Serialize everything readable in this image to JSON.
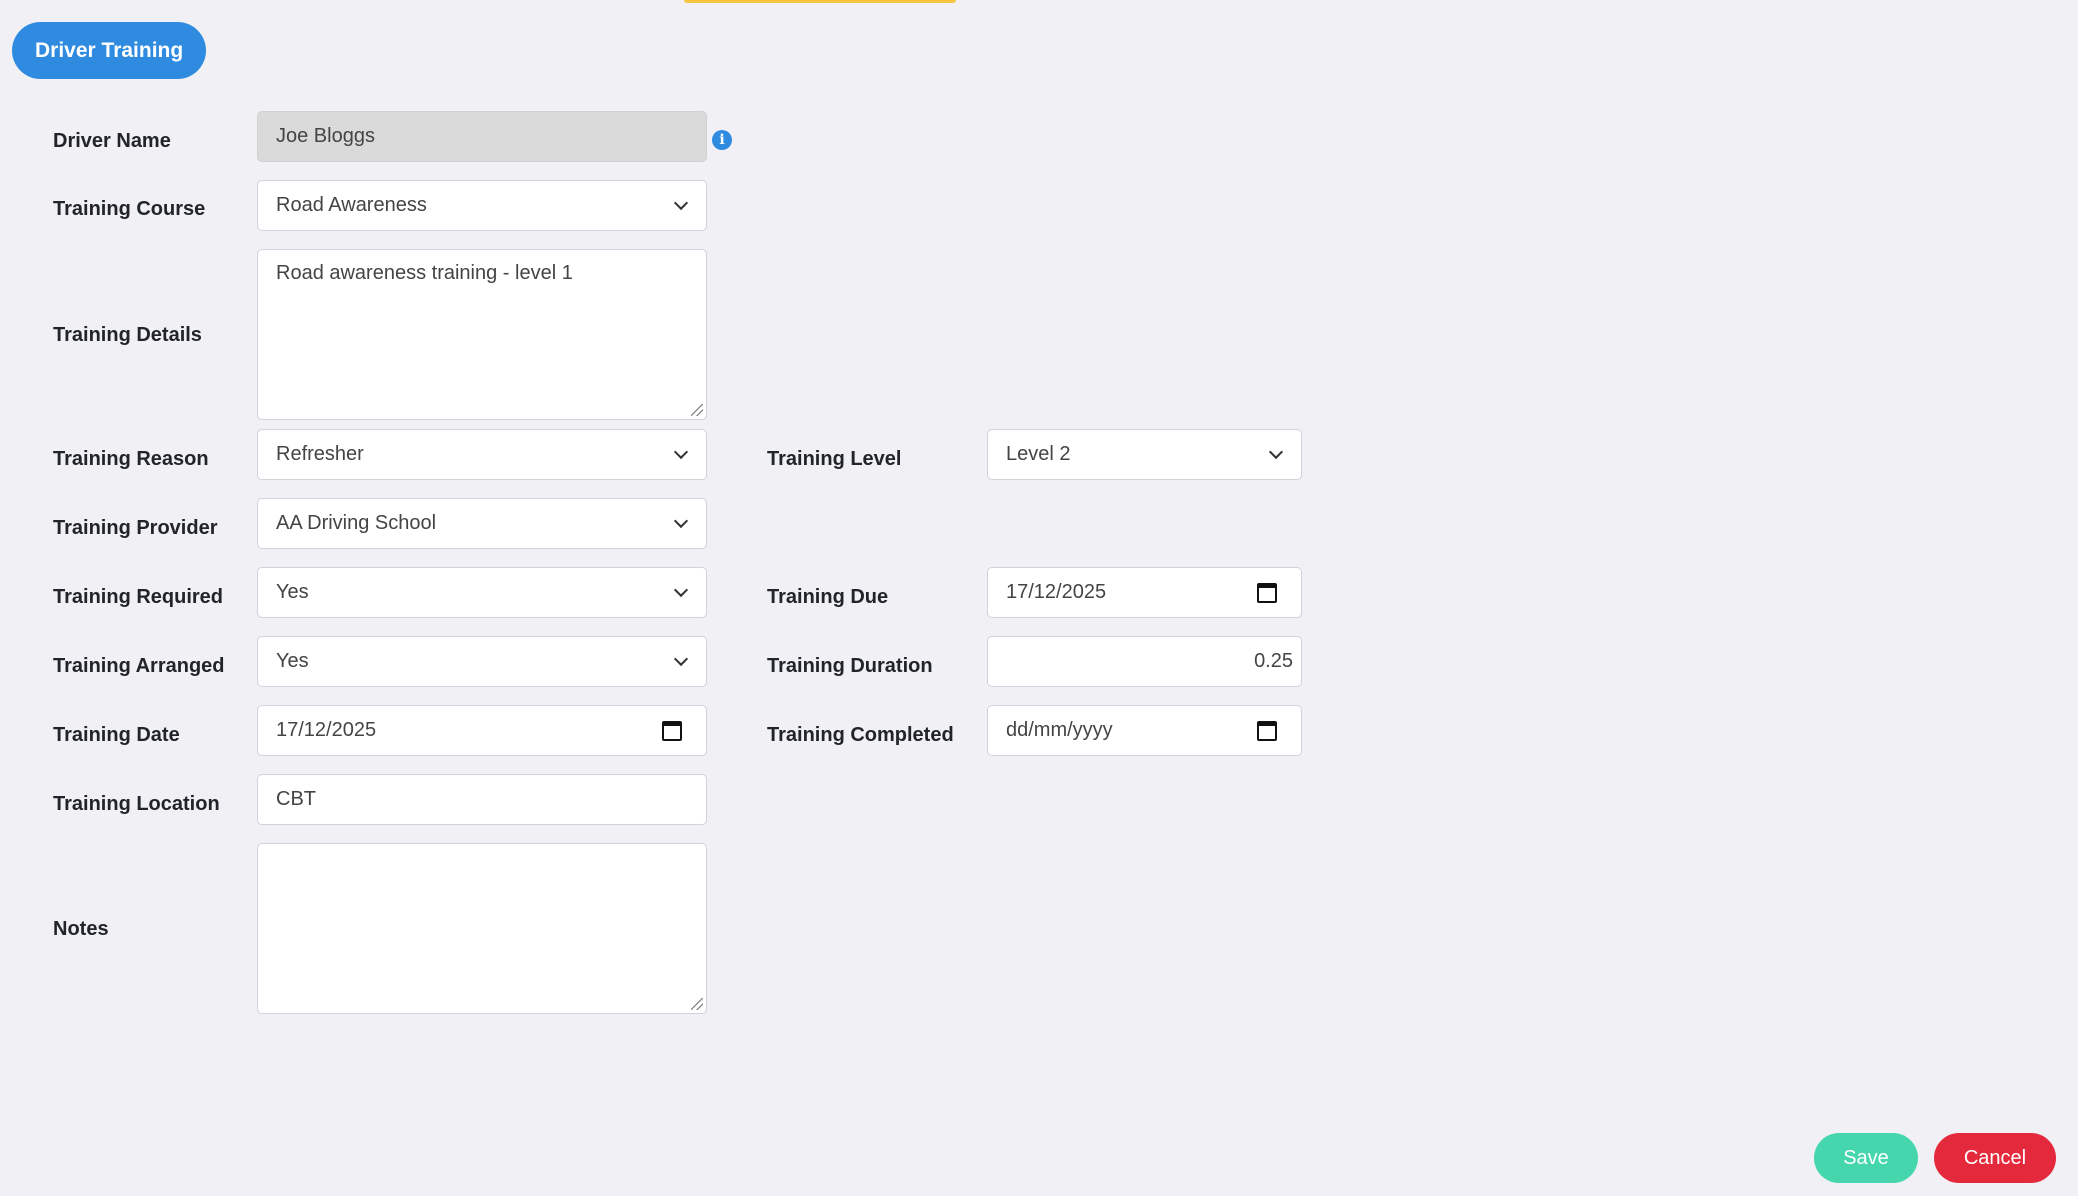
{
  "header": {
    "title": "Driver Training"
  },
  "form": {
    "driver_name": {
      "label": "Driver Name",
      "value": "Joe Bloggs",
      "info_icon": "info-icon"
    },
    "training_course": {
      "label": "Training Course",
      "value": "Road Awareness"
    },
    "training_details": {
      "label": "Training Details",
      "value": "Road awareness training - level 1"
    },
    "training_reason": {
      "label": "Training Reason",
      "value": "Refresher"
    },
    "training_level": {
      "label": "Training Level",
      "value": "Level 2"
    },
    "training_provider": {
      "label": "Training Provider",
      "value": "AA Driving School"
    },
    "training_required": {
      "label": "Training Required",
      "value": "Yes"
    },
    "training_due": {
      "label": "Training Due",
      "value": "17/12/2025"
    },
    "training_arranged": {
      "label": "Training Arranged",
      "value": "Yes"
    },
    "training_duration": {
      "label": "Training Duration",
      "value": "0.25"
    },
    "training_date": {
      "label": "Training Date",
      "value": "17/12/2025"
    },
    "training_completed": {
      "label": "Training Completed",
      "placeholder": "dd/mm/yyyy"
    },
    "training_location": {
      "label": "Training Location",
      "value": "CBT"
    },
    "notes": {
      "label": "Notes",
      "value": ""
    }
  },
  "actions": {
    "save_label": "Save",
    "cancel_label": "Cancel"
  },
  "colors": {
    "primary": "#2f8be0",
    "save": "#46d6ad",
    "cancel": "#e5293d",
    "background": "#f0f0f5"
  }
}
